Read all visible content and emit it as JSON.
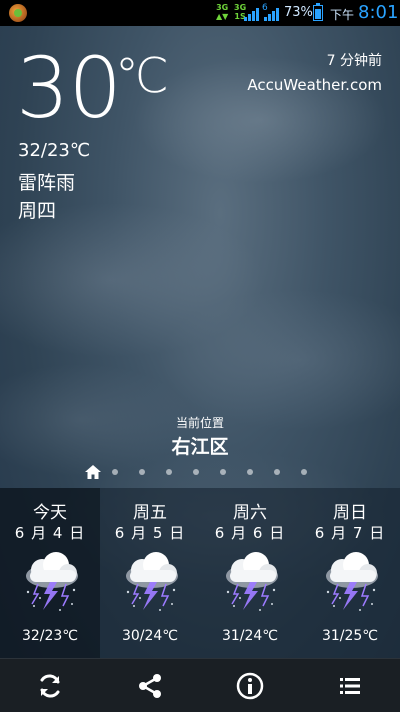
{
  "status_bar": {
    "network_1": "3G",
    "network_2": "3G",
    "sim_2": "6",
    "battery_pct": "73%",
    "ampm": "下午",
    "time": "8:01"
  },
  "current": {
    "temp": "30",
    "unit": "℃",
    "hi_lo": "32/23℃",
    "condition": "雷阵雨",
    "weekday": "周四",
    "updated": "7 分钟前",
    "source": "AccuWeather.com"
  },
  "location": {
    "caption": "当前位置",
    "name": "右江区"
  },
  "pager": {
    "pages": 9,
    "current": 0
  },
  "forecast": [
    {
      "name": "今天",
      "date": "6 月 4 日",
      "temp": "32/23℃",
      "icon": "thunderstorm-icon"
    },
    {
      "name": "周五",
      "date": "6 月 5 日",
      "temp": "30/24℃",
      "icon": "thunderstorm-icon"
    },
    {
      "name": "周六",
      "date": "6 月 6 日",
      "temp": "31/24℃",
      "icon": "thunderstorm-icon"
    },
    {
      "name": "周日",
      "date": "6 月 7 日",
      "temp": "31/25℃",
      "icon": "thunderstorm-icon"
    }
  ],
  "toolbar": [
    {
      "icon": "refresh-icon"
    },
    {
      "icon": "share-icon"
    },
    {
      "icon": "info-icon"
    },
    {
      "icon": "menu-icon"
    }
  ],
  "colors": {
    "accent": "#2aa3ff",
    "lightning": "#9d7bff"
  }
}
